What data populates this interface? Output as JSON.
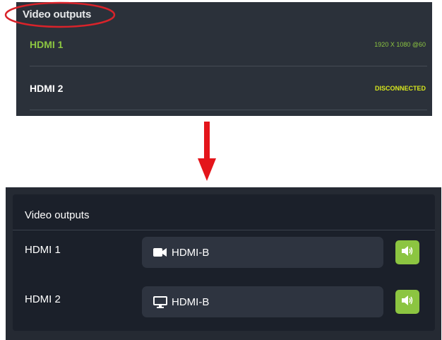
{
  "top_panel": {
    "title": "Video outputs",
    "outputs": [
      {
        "name": "HDMI 1",
        "status": "1920 X 1080 @60"
      },
      {
        "name": "HDMI 2",
        "status": "DISCONNECTED"
      }
    ],
    "colors": {
      "active": "#8cc541",
      "warning": "#d7e71d",
      "annotation": "#d9232a"
    }
  },
  "bottom_panel": {
    "title": "Video outputs",
    "outputs": [
      {
        "name": "HDMI 1",
        "source": "HDMI-B",
        "source_icon": "video-camera-icon",
        "audio_icon": "speaker-icon"
      },
      {
        "name": "HDMI 2",
        "source": "HDMI-B",
        "source_icon": "monitor-icon",
        "audio_icon": "speaker-icon"
      }
    ],
    "colors": {
      "accent": "#8cc541"
    }
  }
}
